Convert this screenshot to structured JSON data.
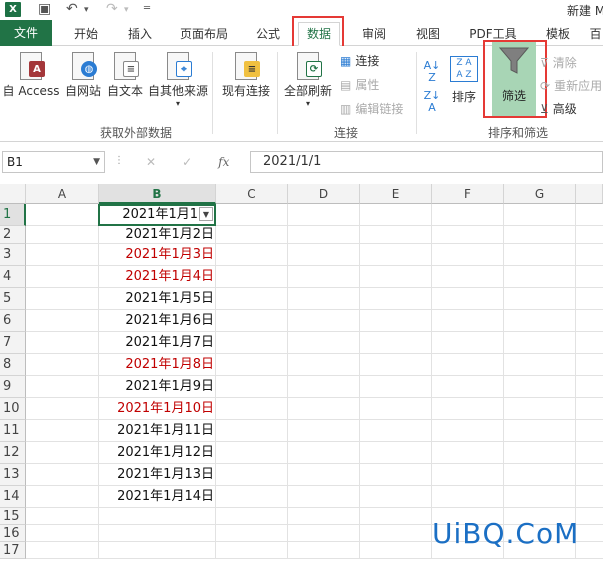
{
  "titlebar": {
    "title": "新建 M"
  },
  "tabs": [
    "文件",
    "开始",
    "插入",
    "页面布局",
    "公式",
    "数据",
    "审阅",
    "视图",
    "PDF工具",
    "模板",
    "百"
  ],
  "ribbon": {
    "external": {
      "buttons": [
        "自 Access",
        "自网站",
        "自文本",
        "自其他来源",
        "现有连接"
      ],
      "group_label": "获取外部数据"
    },
    "connections": {
      "refresh_all": "全部刷新",
      "items": [
        "连接",
        "属性",
        "编辑链接"
      ],
      "group_label": "连接"
    },
    "sort_filter": {
      "sort": "排序",
      "filter": "筛选",
      "items": [
        "清除",
        "重新应用",
        "高级"
      ],
      "group_label": "排序和筛选"
    }
  },
  "formula_bar": {
    "name_box": "B1",
    "fx": "fx",
    "formula": "2021/1/1"
  },
  "grid": {
    "columns": [
      "A",
      "B",
      "C",
      "D",
      "E",
      "F",
      "G"
    ],
    "rows": [
      "1",
      "2",
      "3",
      "4",
      "5",
      "6",
      "7",
      "8",
      "9",
      "10",
      "11",
      "12",
      "13",
      "14",
      "15",
      "16",
      "17"
    ],
    "b_values": [
      "2021年1月1",
      "2021年1月2日",
      "2021年1月3日",
      "2021年1月4日",
      "2021年1月5日",
      "2021年1月6日",
      "2021年1月7日",
      "2021年1月8日",
      "2021年1月9日",
      "2021年1月10日",
      "2021年1月11日",
      "2021年1月12日",
      "2021年1月13日",
      "2021年1月14日"
    ],
    "highlight_color": "#c00000"
  },
  "watermark": "UiBQ.CoM"
}
